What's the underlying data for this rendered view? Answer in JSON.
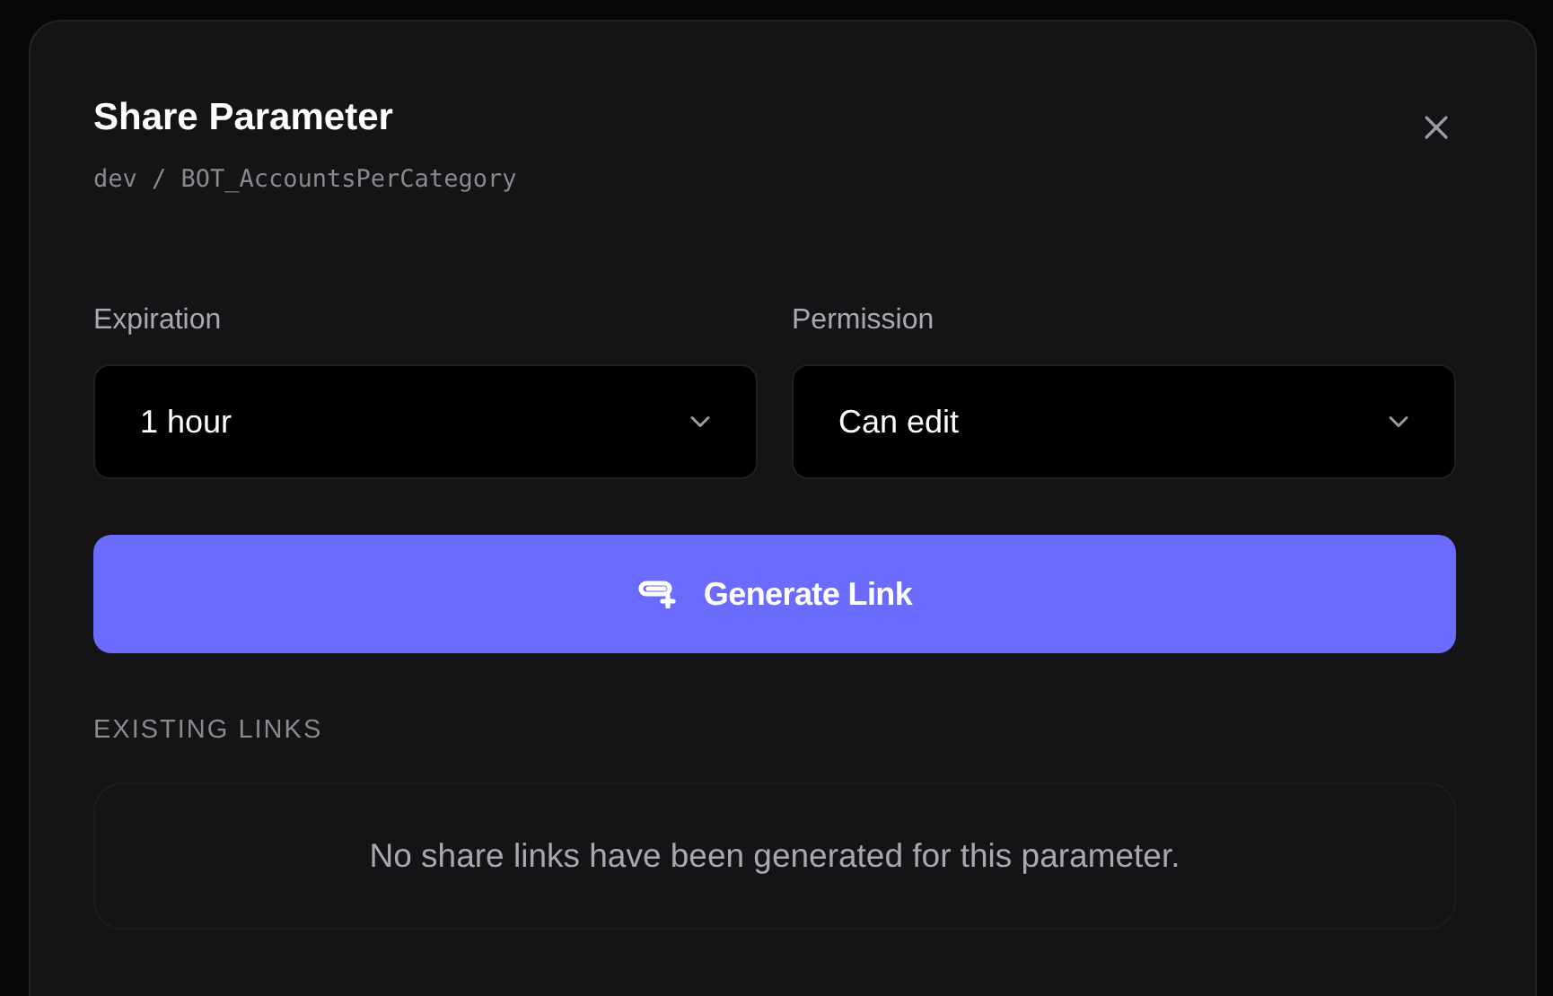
{
  "dialog": {
    "title": "Share Parameter",
    "path": "dev / BOT_AccountsPerCategory"
  },
  "fields": [
    {
      "label": "Expiration",
      "value": "1 hour"
    },
    {
      "label": "Permission",
      "value": "Can edit"
    }
  ],
  "generate_button": "Generate Link",
  "existing_links": {
    "heading": "EXISTING LINKS",
    "empty_message": "No share links have been generated for this parameter."
  }
}
